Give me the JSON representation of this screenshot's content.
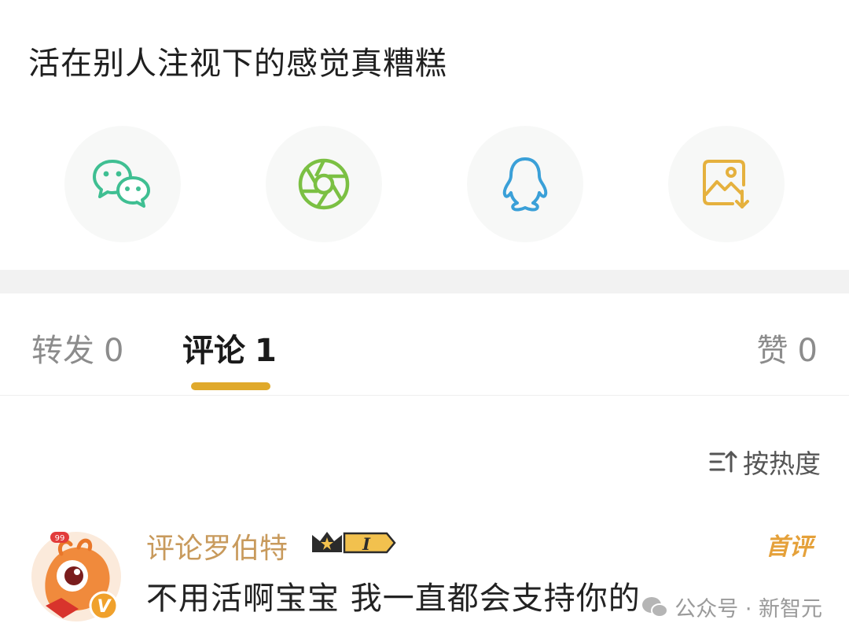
{
  "post": {
    "text": "活在别人注视下的感觉真糟糕"
  },
  "share": {
    "items": [
      {
        "icon": "wechat-icon",
        "color": "#3fbf92"
      },
      {
        "icon": "moments-icon",
        "color": "#7bc043"
      },
      {
        "icon": "qq-icon",
        "color": "#3aa0d8"
      },
      {
        "icon": "save-image-icon",
        "color": "#e5b13e"
      }
    ]
  },
  "tabs": [
    {
      "label": "转发",
      "count": "0"
    },
    {
      "label": "评论",
      "count": "1"
    },
    {
      "label": "赞",
      "count": "0"
    }
  ],
  "sort": {
    "label": "按热度"
  },
  "comment": {
    "username": "评论罗伯特",
    "level_badge": "I",
    "first_label": "首评",
    "text": "不用活啊宝宝 我一直都会支持你的",
    "avatar_badge": "V",
    "avatar_tag": "99"
  },
  "colors": {
    "accent": "#e0a92b",
    "username": "#c89a5c",
    "first_label": "#e5a13a"
  },
  "watermark": {
    "text": "公众号 · 新智元"
  }
}
